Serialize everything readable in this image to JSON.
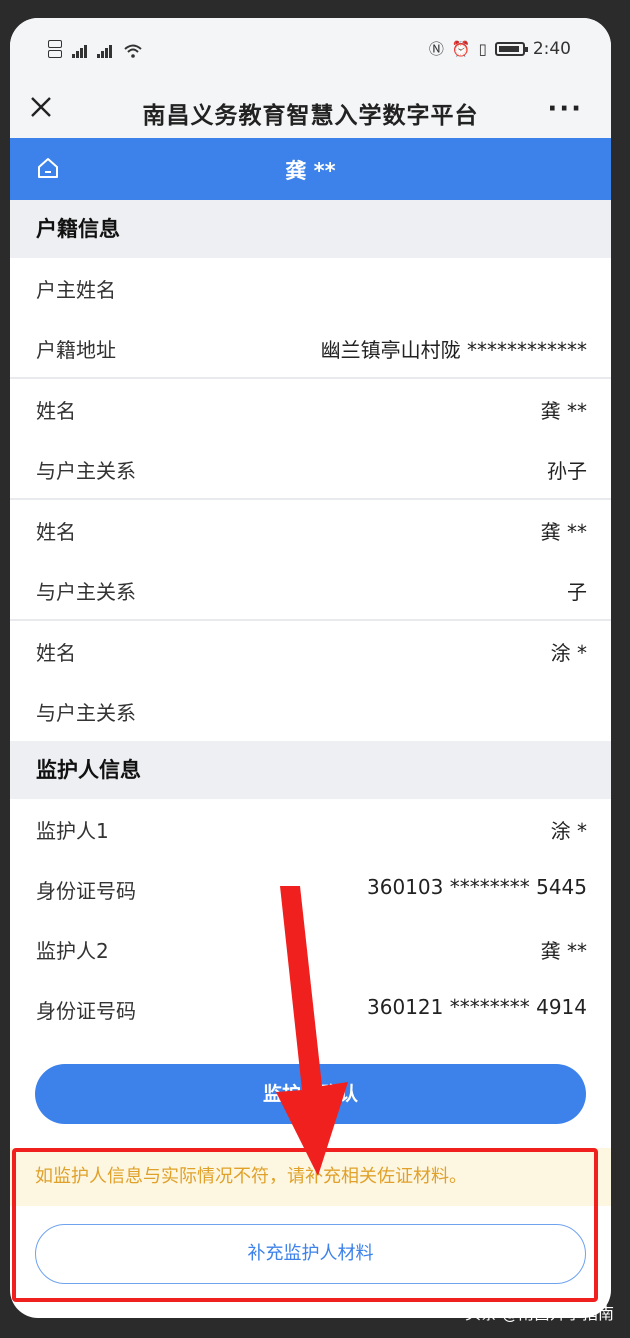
{
  "status_bar": {
    "time": "2:40"
  },
  "title_bar": {
    "title": "南昌义务教育智慧入学数字平台",
    "more": "···"
  },
  "header": {
    "student_name": "龚 **"
  },
  "household": {
    "section_title": "户籍信息",
    "rows": [
      {
        "label": "户主姓名",
        "value": ""
      },
      {
        "label": "户籍地址",
        "value": "幽兰镇亭山村陇 ************"
      },
      {
        "label": "姓名",
        "value": "龚 **"
      },
      {
        "label": "与户主关系",
        "value": "孙子"
      },
      {
        "label": "姓名",
        "value": "龚 **"
      },
      {
        "label": "与户主关系",
        "value": "子"
      },
      {
        "label": "姓名",
        "value": "涂 *"
      },
      {
        "label": "与户主关系",
        "value": ""
      }
    ]
  },
  "guardian": {
    "section_title": "监护人信息",
    "rows": [
      {
        "label": "监护人1",
        "value": "涂 *"
      },
      {
        "label": "身份证号码",
        "value": "360103 ******** 5445"
      },
      {
        "label": "监护人2",
        "value": "龚 **"
      },
      {
        "label": "身份证号码",
        "value": "360121 ******** 4914"
      }
    ]
  },
  "actions": {
    "confirm_label": "监护人确认",
    "notice": "如监护人信息与实际情况不符，请补充相关佐证材料。",
    "supplement_label": "补充监护人材料"
  },
  "watermark": "头条 @南昌升学指南",
  "colors": {
    "accent": "#3c82ea",
    "annotation": "#f0201e",
    "notice_text": "#e0a12a"
  }
}
